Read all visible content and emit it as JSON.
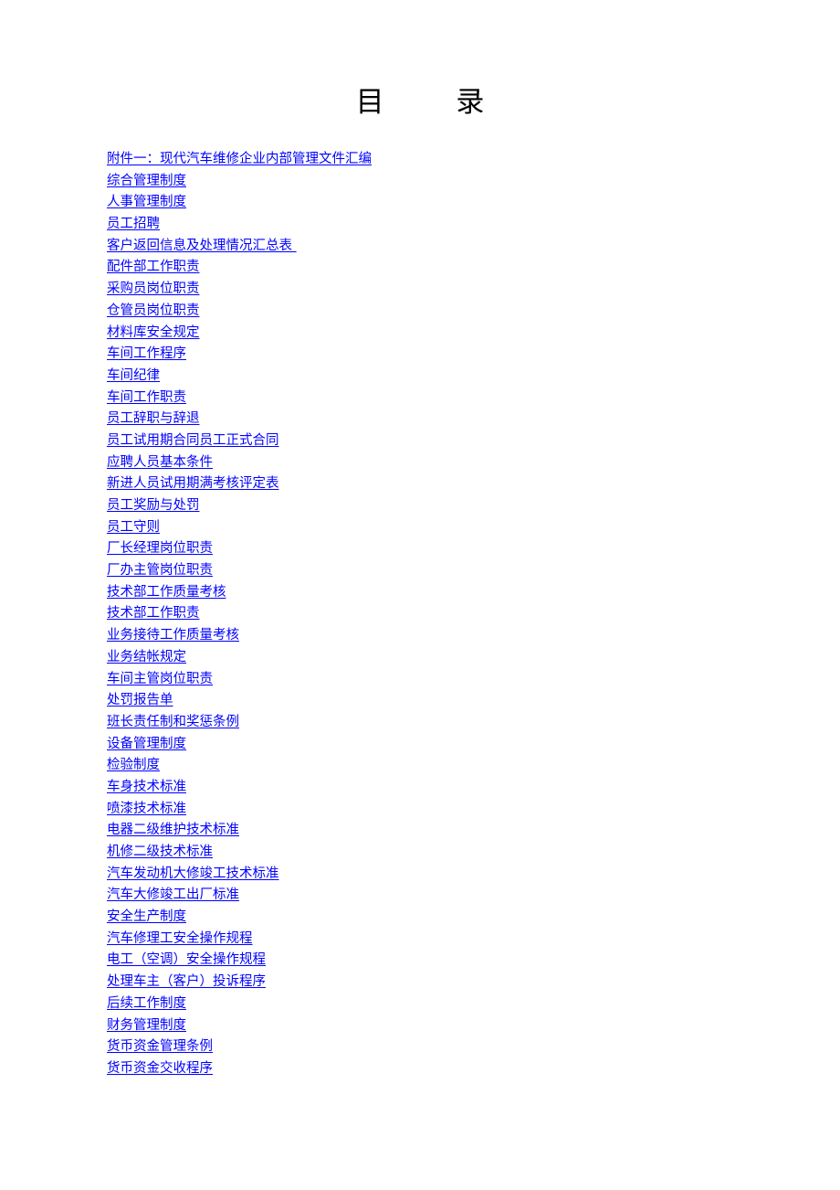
{
  "document": {
    "title": "目        录",
    "title_color": "#000000",
    "background_color": "#ffffff",
    "link_color": "#0000ff"
  },
  "toc": {
    "items": [
      {
        "label": "附件一：现代汽车维修企业内部管理文件汇编"
      },
      {
        "label": "综合管理制度"
      },
      {
        "label": "人事管理制度"
      },
      {
        "label": "员工招聘"
      },
      {
        "label": "客户返回信息及处理情况汇总表 "
      },
      {
        "label": "配件部工作职责"
      },
      {
        "label": "采购员岗位职责"
      },
      {
        "label": "仓管员岗位职责"
      },
      {
        "label": "材料库安全规定"
      },
      {
        "label": "车间工作程序"
      },
      {
        "label": "车间纪律"
      },
      {
        "label": "车间工作职责"
      },
      {
        "label": "员工辞职与辞退"
      },
      {
        "label": "员工试用期合同员工正式合同"
      },
      {
        "label": "应聘人员基本条件"
      },
      {
        "label": "新进人员试用期满考核评定表"
      },
      {
        "label": "员工奖励与处罚"
      },
      {
        "label": "员工守则"
      },
      {
        "label": "厂长经理岗位职责"
      },
      {
        "label": "厂办主管岗位职责"
      },
      {
        "label": "技术部工作质量考核"
      },
      {
        "label": "技术部工作职责"
      },
      {
        "label": "业务接待工作质量考核"
      },
      {
        "label": "业务结帐规定"
      },
      {
        "label": "车间主管岗位职责"
      },
      {
        "label": "处罚报告单"
      },
      {
        "label": "班长责任制和奖惩条例"
      },
      {
        "label": "设备管理制度"
      },
      {
        "label": "检验制度"
      },
      {
        "label": "车身技术标准"
      },
      {
        "label": "喷漆技术标准"
      },
      {
        "label": "电器二级维护技术标准"
      },
      {
        "label": "机修二级技术标准"
      },
      {
        "label": "汽车发动机大修竣工技术标准"
      },
      {
        "label": "汽车大修竣工出厂标准"
      },
      {
        "label": "安全生产制度"
      },
      {
        "label": "汽车修理工安全操作规程"
      },
      {
        "label": "电工（空调）安全操作规程"
      },
      {
        "label": "处理车主（客户）投诉程序"
      },
      {
        "label": "后续工作制度"
      },
      {
        "label": "财务管理制度"
      },
      {
        "label": "货币资金管理条例"
      },
      {
        "label": "货币资金交收程序"
      }
    ]
  }
}
